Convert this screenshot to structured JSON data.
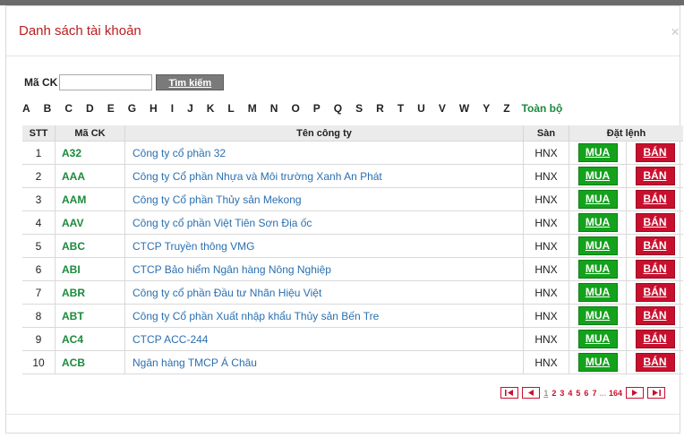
{
  "modal": {
    "title": "Danh sách tài khoản",
    "close": "×"
  },
  "search": {
    "label": "Mã CK",
    "value": "",
    "button": "Tìm kiếm"
  },
  "alphabet": [
    "A",
    "B",
    "C",
    "D",
    "E",
    "G",
    "H",
    "I",
    "J",
    "K",
    "L",
    "M",
    "N",
    "O",
    "P",
    "Q",
    "S",
    "R",
    "T",
    "U",
    "V",
    "W",
    "Y",
    "Z"
  ],
  "all_label": "Toàn bộ",
  "table": {
    "headers": {
      "stt": "STT",
      "code": "Mã CK",
      "name": "Tên công ty",
      "san": "Sàn",
      "order": "Đặt lệnh"
    },
    "rows": [
      {
        "stt": "1",
        "code": "A32",
        "name": "Công ty cổ phần 32",
        "san": "HNX",
        "buy": "MUA",
        "sell": "BÁN"
      },
      {
        "stt": "2",
        "code": "AAA",
        "name": "Công ty Cổ phần Nhựa và Môi trường Xanh An Phát",
        "san": "HNX",
        "buy": "MUA",
        "sell": "BÁN"
      },
      {
        "stt": "3",
        "code": "AAM",
        "name": "Công ty Cổ phần Thủy sản Mekong",
        "san": "HNX",
        "buy": "MUA",
        "sell": "BÁN"
      },
      {
        "stt": "4",
        "code": "AAV",
        "name": "Công ty cổ phần Việt Tiên Sơn Địa ốc",
        "san": "HNX",
        "buy": "MUA",
        "sell": "BÁN"
      },
      {
        "stt": "5",
        "code": "ABC",
        "name": "CTCP Truyền thông VMG",
        "san": "HNX",
        "buy": "MUA",
        "sell": "BÁN"
      },
      {
        "stt": "6",
        "code": "ABI",
        "name": "CTCP Bảo hiểm Ngân hàng Nông Nghiệp",
        "san": "HNX",
        "buy": "MUA",
        "sell": "BÁN"
      },
      {
        "stt": "7",
        "code": "ABR",
        "name": "Công ty cổ phần Đầu tư Nhãn Hiệu Việt",
        "san": "HNX",
        "buy": "MUA",
        "sell": "BÁN"
      },
      {
        "stt": "8",
        "code": "ABT",
        "name": "Công ty Cổ phần Xuất nhập khẩu Thủy sản Bến Tre",
        "san": "HNX",
        "buy": "MUA",
        "sell": "BÁN"
      },
      {
        "stt": "9",
        "code": "AC4",
        "name": "CTCP ACC-244",
        "san": "HNX",
        "buy": "MUA",
        "sell": "BÁN"
      },
      {
        "stt": "10",
        "code": "ACB",
        "name": "Ngân hàng TMCP Á Châu",
        "san": "HNX",
        "buy": "MUA",
        "sell": "BÁN"
      }
    ]
  },
  "pager": {
    "pages": [
      "1",
      "2",
      "3",
      "4",
      "5",
      "6",
      "7"
    ],
    "current": "1",
    "ellipsis": "...",
    "last": "164",
    "icons": [
      "first-page-icon",
      "prev-page-icon",
      "next-page-icon",
      "last-page-icon"
    ]
  },
  "colors": {
    "title": "#b81e1e",
    "code": "#1b8a3c",
    "link": "#2a6fb0",
    "buy": "#14a21c",
    "sell": "#c8102e"
  }
}
